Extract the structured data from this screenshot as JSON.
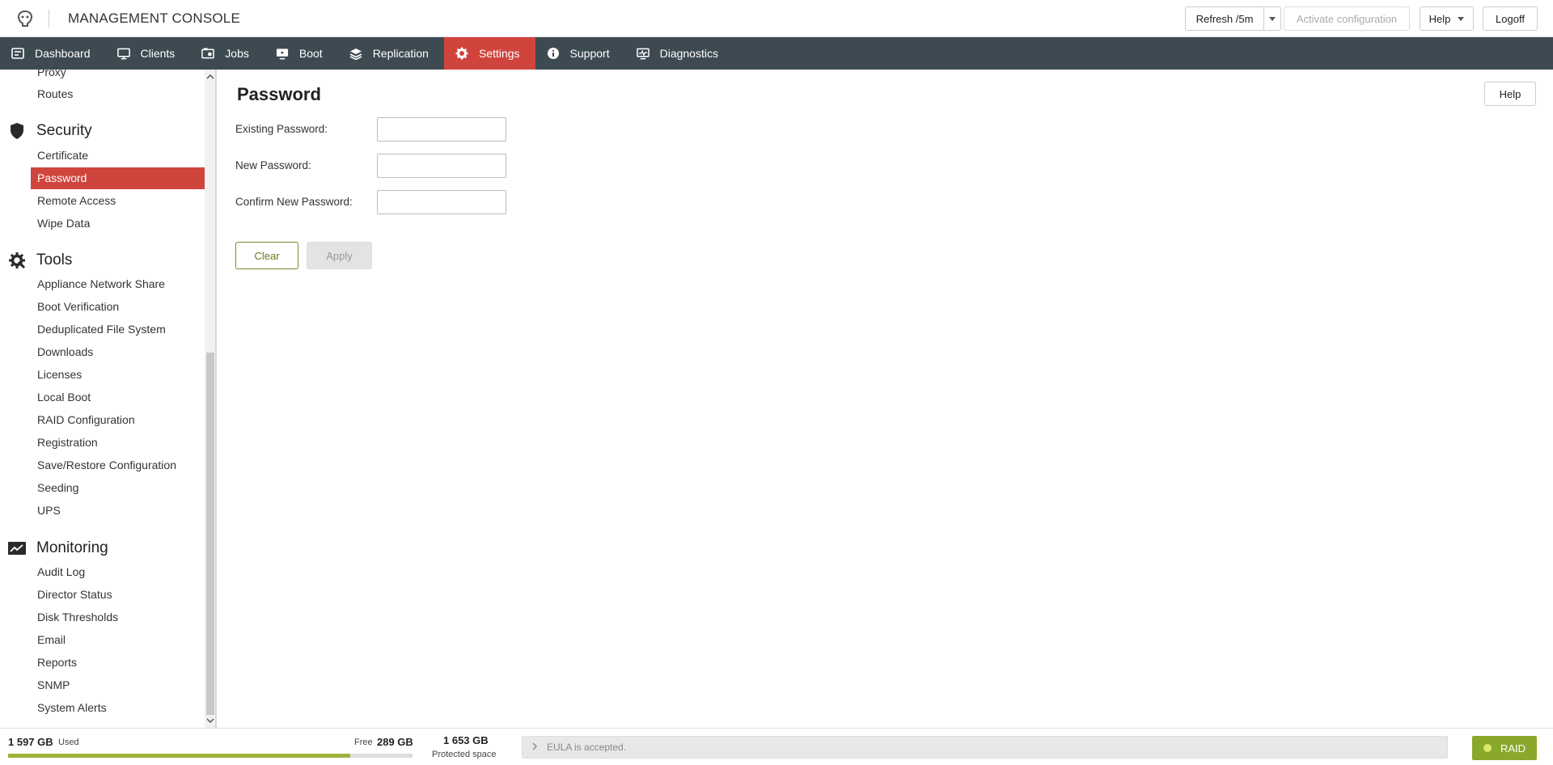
{
  "header": {
    "title": "MANAGEMENT CONSOLE",
    "refresh_label": "Refresh /5m",
    "activate_label": "Activate configuration",
    "help_label": "Help",
    "logoff_label": "Logoff"
  },
  "nav": {
    "items": [
      {
        "label": "Dashboard",
        "icon": "dashboard-icon"
      },
      {
        "label": "Clients",
        "icon": "monitor-icon"
      },
      {
        "label": "Jobs",
        "icon": "jobs-icon"
      },
      {
        "label": "Boot",
        "icon": "boot-icon"
      },
      {
        "label": "Replication",
        "icon": "layers-icon"
      },
      {
        "label": "Settings",
        "icon": "gear-icon",
        "active": true
      },
      {
        "label": "Support",
        "icon": "info-icon"
      },
      {
        "label": "Diagnostics",
        "icon": "diagnostics-icon"
      }
    ]
  },
  "sidebar": {
    "partial_top": [
      "Proxy",
      "Routes"
    ],
    "security": {
      "title": "Security",
      "items": [
        "Certificate",
        "Password",
        "Remote Access",
        "Wipe Data"
      ],
      "active": "Password"
    },
    "tools": {
      "title": "Tools",
      "items": [
        "Appliance Network Share",
        "Boot Verification",
        "Deduplicated File System",
        "Downloads",
        "Licenses",
        "Local Boot",
        "RAID Configuration",
        "Registration",
        "Save/Restore Configuration",
        "Seeding",
        "UPS"
      ]
    },
    "monitoring": {
      "title": "Monitoring",
      "items": [
        "Audit Log",
        "Director Status",
        "Disk Thresholds",
        "Email",
        "Reports",
        "SNMP",
        "System Alerts"
      ]
    }
  },
  "main": {
    "title": "Password",
    "help_label": "Help",
    "fields": [
      {
        "label": "Existing Password:",
        "value": ""
      },
      {
        "label": "New Password:",
        "value": ""
      },
      {
        "label": "Confirm New Password:",
        "value": ""
      }
    ],
    "clear_label": "Clear",
    "apply_label": "Apply"
  },
  "footer": {
    "used_value": "1 597 GB",
    "used_label": "Used",
    "free_label": "Free",
    "free_value": "289 GB",
    "used_fraction": 0.8468,
    "protected_value": "1 653 GB",
    "protected_label": "Protected space",
    "eula_text": "EULA is accepted.",
    "raid_label": "RAID"
  },
  "colors": {
    "accent": "#d0443e",
    "nav_bg": "#3d4a52",
    "ok_green": "#8aa92a",
    "clear_btn": "#6b7a1f"
  }
}
